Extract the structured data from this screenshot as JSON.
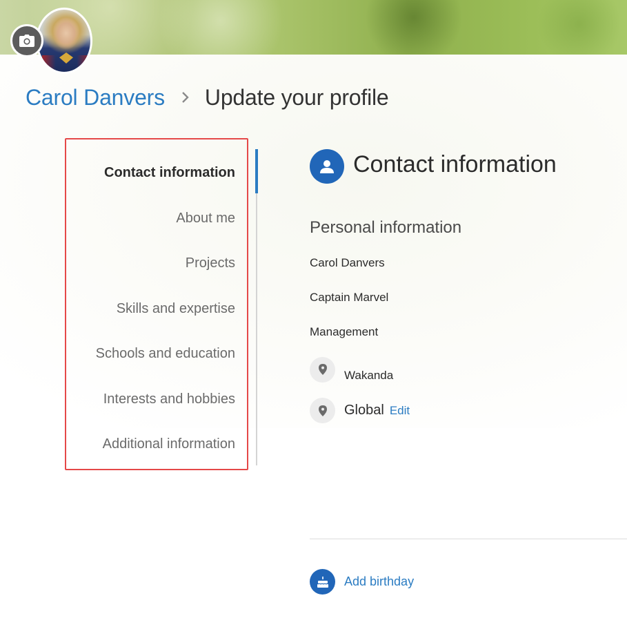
{
  "profile": {
    "name": "Carol Danvers",
    "breadcrumb_current": "Update your profile"
  },
  "nav": {
    "items": [
      {
        "label": "Contact information",
        "active": true
      },
      {
        "label": "About me",
        "active": false
      },
      {
        "label": "Projects",
        "active": false
      },
      {
        "label": "Skills and expertise",
        "active": false
      },
      {
        "label": "Schools and education",
        "active": false
      },
      {
        "label": "Interests and hobbies",
        "active": false
      },
      {
        "label": "Additional information",
        "active": false
      }
    ]
  },
  "contact": {
    "title": "Contact information",
    "subheading": "Personal information",
    "name": "Carol Danvers",
    "job_title": "Captain Marvel",
    "department": "Management",
    "office_location": "Wakanda",
    "region": "Global",
    "edit_label": "Edit",
    "birthday_label": "Add birthday"
  },
  "icons": {
    "camera": "camera-icon",
    "chevron": "chevron-right-icon",
    "person": "person-icon",
    "pin": "map-pin-icon",
    "cake": "cake-icon"
  },
  "colors": {
    "accent": "#2b7cc2",
    "icon_blue": "#2166b8",
    "highlight_border": "#e54848"
  }
}
